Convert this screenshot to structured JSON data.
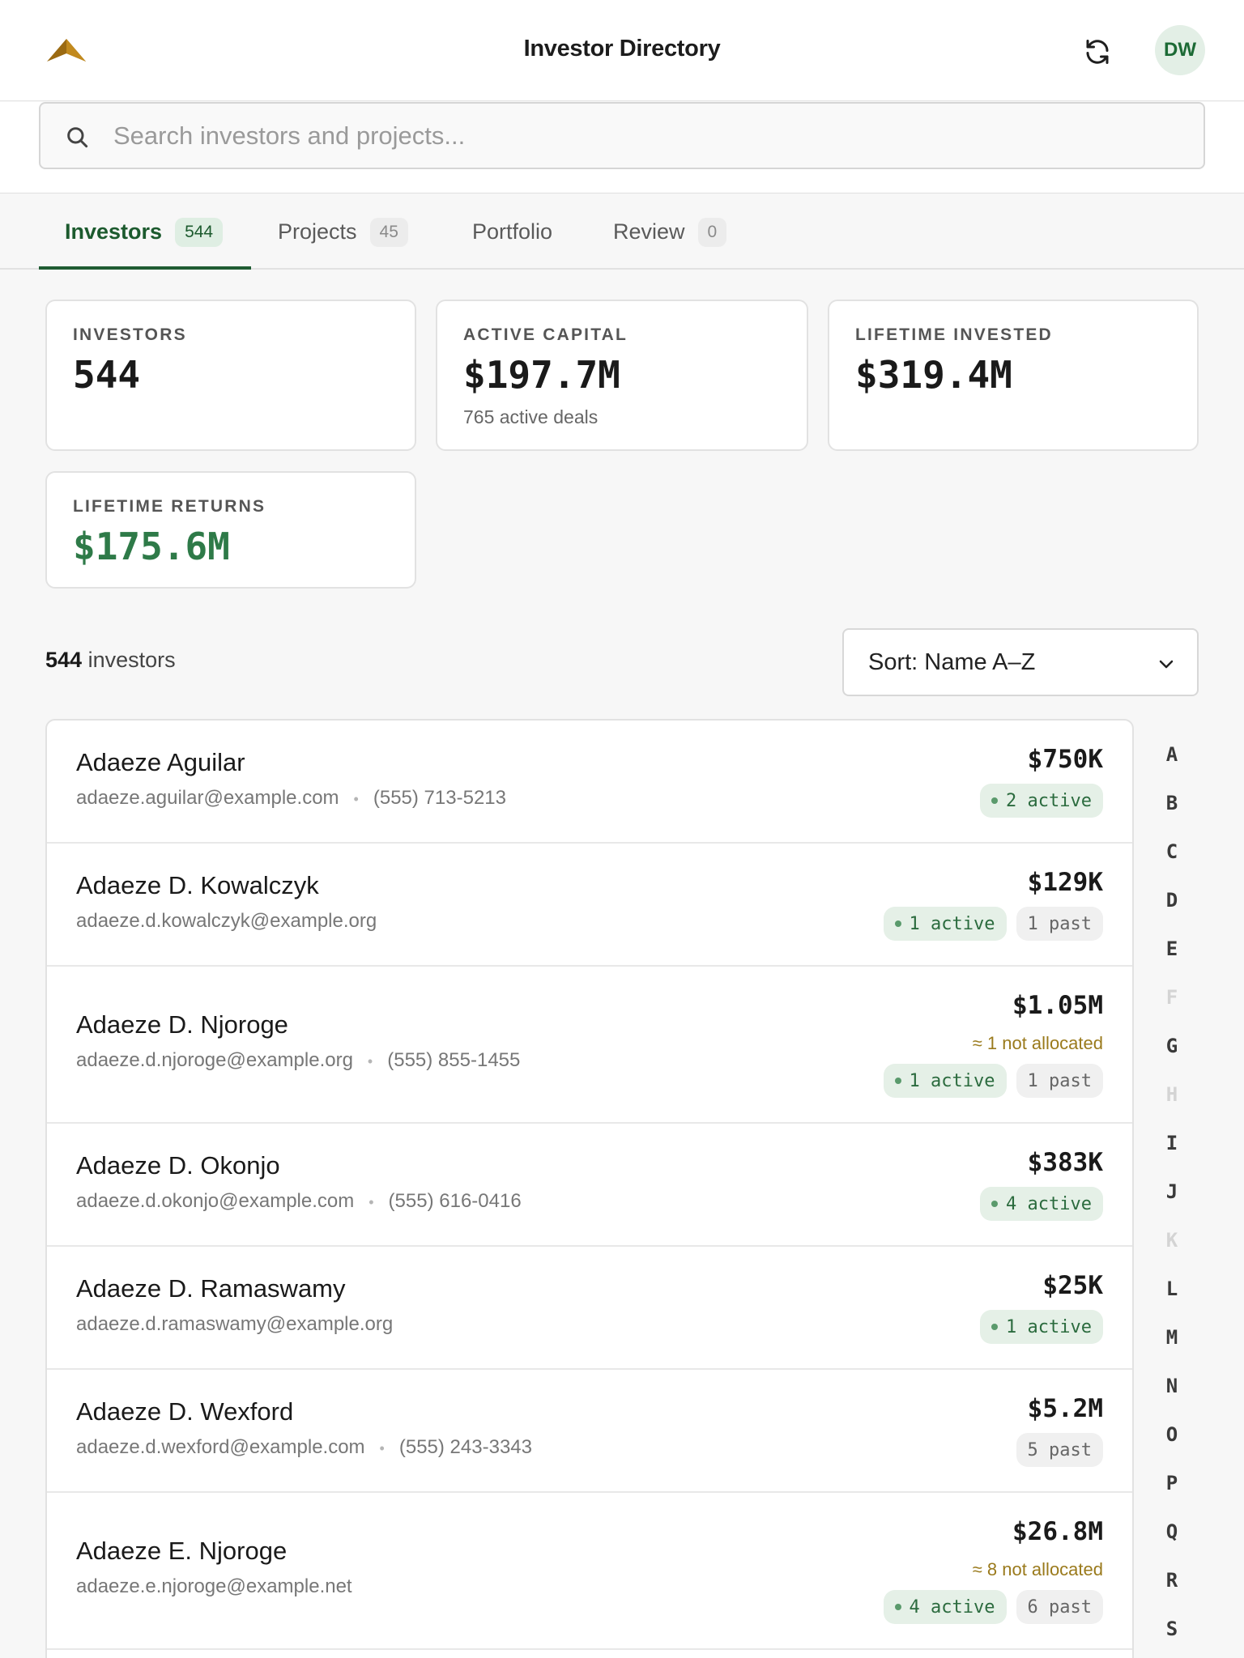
{
  "header": {
    "title": "Investor Directory",
    "avatar_initials": "DW",
    "logo_icon": "mountain-logo",
    "refresh_icon": "refresh-icon"
  },
  "search": {
    "placeholder": "Search investors and projects..."
  },
  "tabs": [
    {
      "label": "Investors",
      "count": "544",
      "active": true
    },
    {
      "label": "Projects",
      "count": "45",
      "active": false
    },
    {
      "label": "Portfolio",
      "count": "",
      "active": false
    },
    {
      "label": "Review",
      "count": "0",
      "active": false
    }
  ],
  "stats": {
    "investors": {
      "label": "INVESTORS",
      "value": "544"
    },
    "active_capital": {
      "label": "ACTIVE CAPITAL",
      "value": "$197.7M",
      "sub": "765 active deals"
    },
    "lifetime_invested": {
      "label": "LIFETIME INVESTED",
      "value": "$319.4M"
    },
    "lifetime_returns": {
      "label": "LIFETIME RETURNS",
      "value": "$175.6M"
    }
  },
  "list_header": {
    "count": "544",
    "count_suffix": " investors",
    "sort_label": "Sort: Name A–Z"
  },
  "investors": [
    {
      "name": "Adaeze Aguilar",
      "email": "adaeze.aguilar@example.com",
      "phone": "(555) 713-5213",
      "amount": "$750K",
      "unallocated": "",
      "active": "2 active",
      "past": ""
    },
    {
      "name": "Adaeze D. Kowalczyk",
      "email": "adaeze.d.kowalczyk@example.org",
      "phone": "",
      "amount": "$129K",
      "unallocated": "",
      "active": "1 active",
      "past": "1 past"
    },
    {
      "name": "Adaeze D. Njoroge",
      "email": "adaeze.d.njoroge@example.org",
      "phone": "(555) 855-1455",
      "amount": "$1.05M",
      "unallocated": "≈ 1 not allocated",
      "active": "1 active",
      "past": "1 past"
    },
    {
      "name": "Adaeze D. Okonjo",
      "email": "adaeze.d.okonjo@example.com",
      "phone": "(555) 616-0416",
      "amount": "$383K",
      "unallocated": "",
      "active": "4 active",
      "past": ""
    },
    {
      "name": "Adaeze D. Ramaswamy",
      "email": "adaeze.d.ramaswamy@example.org",
      "phone": "",
      "amount": "$25K",
      "unallocated": "",
      "active": "1 active",
      "past": ""
    },
    {
      "name": "Adaeze D. Wexford",
      "email": "adaeze.d.wexford@example.com",
      "phone": "(555) 243-3343",
      "amount": "$5.2M",
      "unallocated": "",
      "active": "",
      "past": "5 past"
    },
    {
      "name": "Adaeze E. Njoroge",
      "email": "adaeze.e.njoroge@example.net",
      "phone": "",
      "amount": "$26.8M",
      "unallocated": "≈ 8 not allocated",
      "active": "4 active",
      "past": "6 past"
    }
  ],
  "alpha_index": [
    {
      "letter": "A",
      "enabled": true
    },
    {
      "letter": "B",
      "enabled": true
    },
    {
      "letter": "C",
      "enabled": true
    },
    {
      "letter": "D",
      "enabled": true
    },
    {
      "letter": "E",
      "enabled": true
    },
    {
      "letter": "F",
      "enabled": false
    },
    {
      "letter": "G",
      "enabled": true
    },
    {
      "letter": "H",
      "enabled": false
    },
    {
      "letter": "I",
      "enabled": true
    },
    {
      "letter": "J",
      "enabled": true
    },
    {
      "letter": "K",
      "enabled": false
    },
    {
      "letter": "L",
      "enabled": true
    },
    {
      "letter": "M",
      "enabled": true
    },
    {
      "letter": "N",
      "enabled": true
    },
    {
      "letter": "O",
      "enabled": true
    },
    {
      "letter": "P",
      "enabled": true
    },
    {
      "letter": "Q",
      "enabled": true
    },
    {
      "letter": "R",
      "enabled": true
    },
    {
      "letter": "S",
      "enabled": true
    }
  ],
  "colors": {
    "brand_green": "#1f5c33",
    "returns_green": "#2e7a48",
    "unallocated_amber": "#9a7a1c"
  }
}
